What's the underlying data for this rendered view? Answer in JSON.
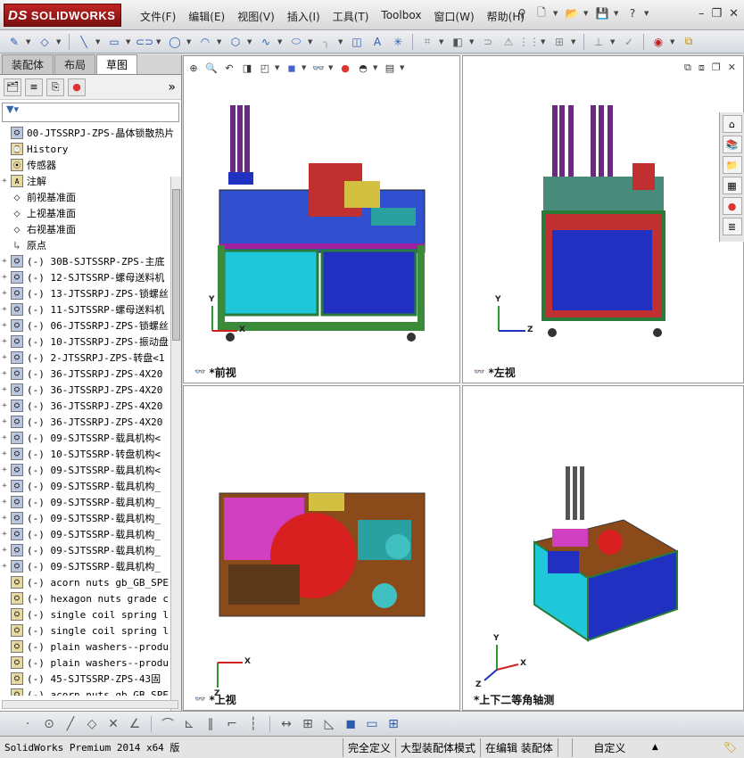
{
  "app": {
    "logo": "SOLIDWORKS",
    "logo_mark": "DS"
  },
  "menu": [
    "文件(F)",
    "编辑(E)",
    "视图(V)",
    "插入(I)",
    "工具(T)",
    "Toolbox",
    "窗口(W)",
    "帮助(H)"
  ],
  "left_tabs": [
    "装配体",
    "布局",
    "草图"
  ],
  "active_left_tab": "草图",
  "tree": {
    "root": "00-JTSSRPJ-ZPS-晶体锁散热片",
    "items": [
      {
        "label": "History",
        "icon": "history-icon",
        "exp": ""
      },
      {
        "label": "传感器",
        "icon": "sensor-icon",
        "exp": ""
      },
      {
        "label": "注解",
        "icon": "annotation-icon",
        "exp": "+"
      },
      {
        "label": "前视基准面",
        "icon": "plane-icon",
        "exp": ""
      },
      {
        "label": "上视基准面",
        "icon": "plane-icon",
        "exp": ""
      },
      {
        "label": "右视基准面",
        "icon": "plane-icon",
        "exp": ""
      },
      {
        "label": "原点",
        "icon": "origin-icon",
        "exp": ""
      },
      {
        "label": "(-) 30B-SJTSSRP-ZPS-主底",
        "icon": "assembly-icon",
        "exp": "+"
      },
      {
        "label": "(-) 12-SJTSSRP-螺母送料机",
        "icon": "assembly-icon",
        "exp": "+"
      },
      {
        "label": "(-) 13-JTSSRPJ-ZPS-锁螺丝",
        "icon": "assembly-icon",
        "exp": "+"
      },
      {
        "label": "(-) 11-SJTSSRP-螺母送料机",
        "icon": "assembly-icon",
        "exp": "+"
      },
      {
        "label": "(-) 06-JTSSRPJ-ZPS-锁螺丝",
        "icon": "assembly-icon",
        "exp": "+"
      },
      {
        "label": "(-) 10-JTSSRPJ-ZPS-振动盘",
        "icon": "assembly-icon",
        "exp": "+"
      },
      {
        "label": "(-) 2-JTSSRPJ-ZPS-转盘<1",
        "icon": "assembly-icon",
        "exp": "+"
      },
      {
        "label": "(-) 36-JTSSRPJ-ZPS-4X20",
        "icon": "assembly-icon",
        "exp": "+"
      },
      {
        "label": "(-) 36-JTSSRPJ-ZPS-4X20",
        "icon": "assembly-icon",
        "exp": "+"
      },
      {
        "label": "(-) 36-JTSSRPJ-ZPS-4X20",
        "icon": "assembly-icon",
        "exp": "+"
      },
      {
        "label": "(-) 36-JTSSRPJ-ZPS-4X20",
        "icon": "assembly-icon",
        "exp": "+"
      },
      {
        "label": "(-) 09-SJTSSRP-载具机构<",
        "icon": "assembly-icon",
        "exp": "+"
      },
      {
        "label": "(-) 10-SJTSSRP-转盘机构<",
        "icon": "assembly-icon",
        "exp": "+"
      },
      {
        "label": "(-) 09-SJTSSRP-载具机构<",
        "icon": "assembly-icon",
        "exp": "+"
      },
      {
        "label": "(-) 09-SJTSSRP-载具机构_",
        "icon": "assembly-icon",
        "exp": "+"
      },
      {
        "label": "(-) 09-SJTSSRP-载具机构_",
        "icon": "assembly-icon",
        "exp": "+"
      },
      {
        "label": "(-) 09-SJTSSRP-载具机构_",
        "icon": "assembly-icon",
        "exp": "+"
      },
      {
        "label": "(-) 09-SJTSSRP-载具机构_",
        "icon": "assembly-icon",
        "exp": "+"
      },
      {
        "label": "(-) 09-SJTSSRP-载具机构_",
        "icon": "assembly-icon",
        "exp": "+"
      },
      {
        "label": "(-) 09-SJTSSRP-载具机构_",
        "icon": "assembly-icon",
        "exp": "+"
      },
      {
        "label": "(-) acorn nuts gb_GB_SPE",
        "icon": "part-icon",
        "exp": ""
      },
      {
        "label": "(-) hexagon nuts grade c",
        "icon": "part-icon",
        "exp": ""
      },
      {
        "label": "(-) single coil spring l",
        "icon": "part-icon",
        "exp": ""
      },
      {
        "label": "(-) single coil spring l",
        "icon": "part-icon",
        "exp": ""
      },
      {
        "label": "(-) plain washers--produ",
        "icon": "part-icon",
        "exp": ""
      },
      {
        "label": "(-) plain washers--produ",
        "icon": "part-icon",
        "exp": ""
      },
      {
        "label": "(-) 45-SJTSSRP-ZPS-43固",
        "icon": "part-icon",
        "exp": ""
      },
      {
        "label": "(-) acorn nuts gb_GB_SPE",
        "icon": "part-icon",
        "exp": ""
      }
    ]
  },
  "viewports": {
    "front": "*前视",
    "left": "*左视",
    "top": "*上视",
    "iso": "*上下二等角轴测"
  },
  "axes": {
    "x": "X",
    "y": "Y",
    "z": "Z"
  },
  "status": {
    "product": "SolidWorks Premium 2014 x64 版",
    "defined": "完全定义",
    "mode": "大型装配体模式",
    "editing": "在编辑 装配体",
    "units": "自定义"
  }
}
